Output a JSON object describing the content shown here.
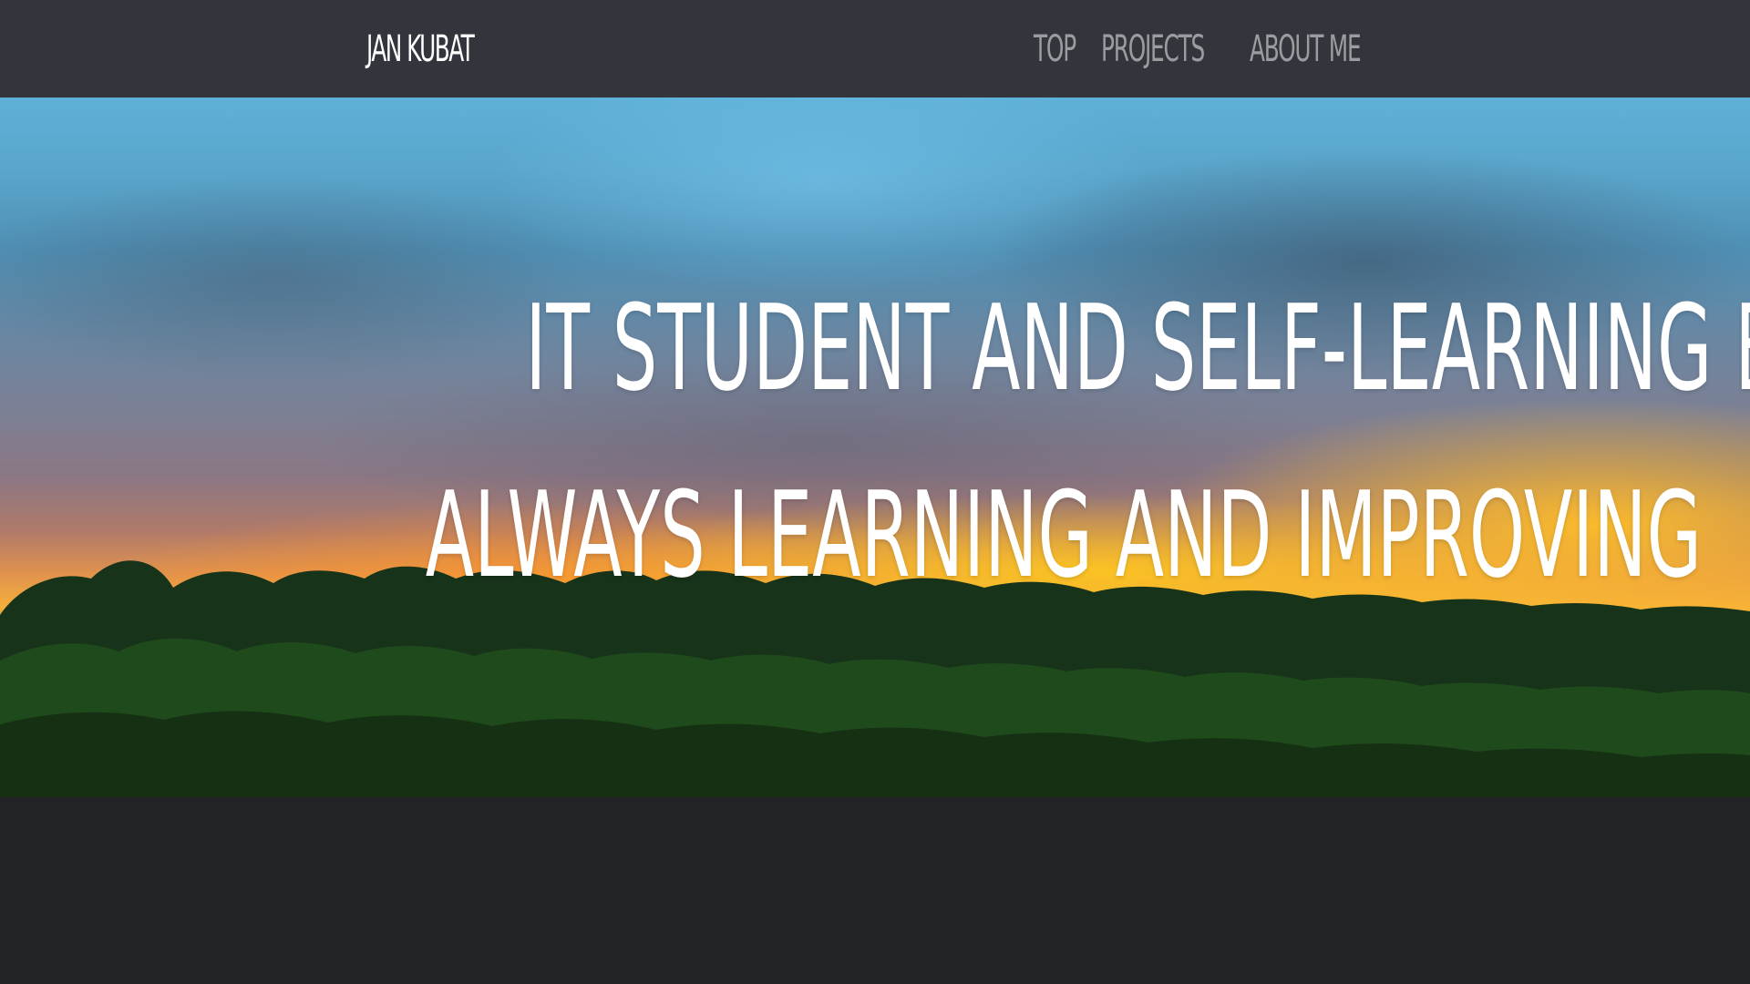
{
  "navbar": {
    "brand": "JAN KUBAT",
    "links": [
      "TOP",
      "PROJECTS",
      "ABOUT ME"
    ]
  },
  "hero": {
    "headline": "IT STUDENT AND SELF-LEARNING ENGINEER",
    "subheadline": "ALWAYS LEARNING AND IMPROVING"
  },
  "colors": {
    "navbar_bg": "#32353b",
    "page_bg": "#212327",
    "brand_text": "#ffffff",
    "nav_link_text": "#9b9c9f",
    "hero_text": "#ffffff"
  }
}
